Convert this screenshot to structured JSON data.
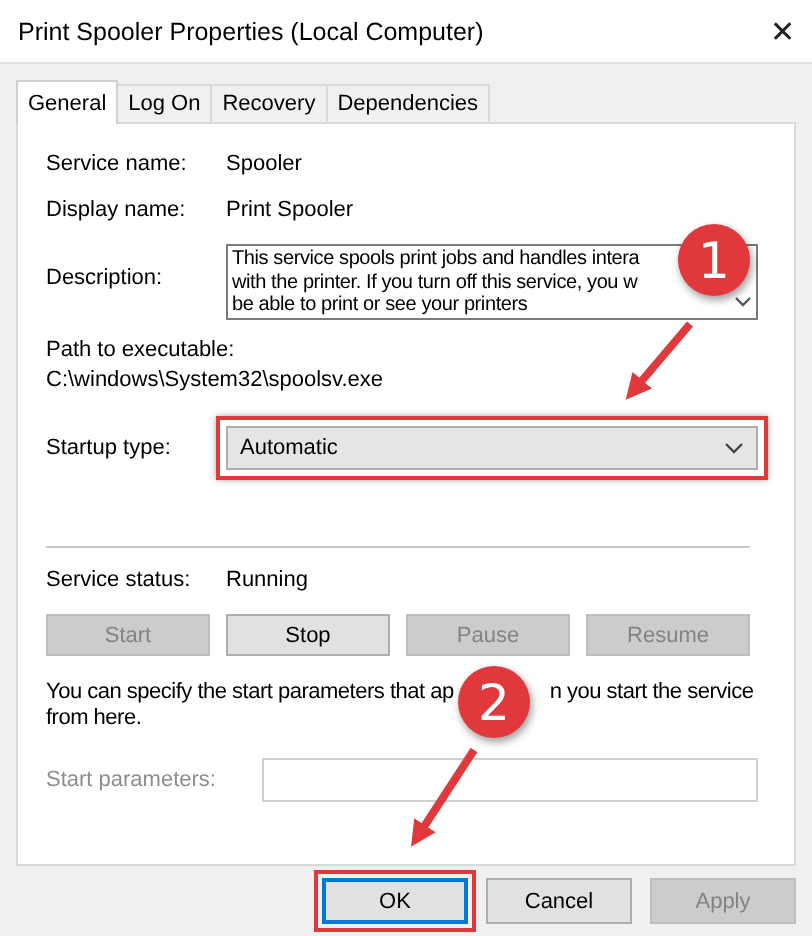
{
  "window": {
    "title": "Print Spooler Properties (Local Computer)",
    "close": "✕"
  },
  "tabs": [
    {
      "label": "General",
      "selected": true
    },
    {
      "label": "Log On",
      "selected": false
    },
    {
      "label": "Recovery",
      "selected": false
    },
    {
      "label": "Dependencies",
      "selected": false
    }
  ],
  "service_name": {
    "label": "Service name:",
    "value": "Spooler"
  },
  "display_name": {
    "label": "Display name:",
    "value": "Print Spooler"
  },
  "description": {
    "label": "Description:",
    "lines": [
      "This service spools print jobs and handles intera",
      "with the printer.  If you turn off this service, you w",
      "be able to print or see your printers"
    ]
  },
  "path": {
    "label": "Path to executable:",
    "value": "C:\\windows\\System32\\spoolsv.exe"
  },
  "startup_type": {
    "label": "Startup type:",
    "value": "Automatic",
    "highlighted": true
  },
  "service_status": {
    "label": "Service status:",
    "value": "Running"
  },
  "service_buttons": [
    {
      "label": "Start",
      "disabled": true
    },
    {
      "label": "Stop",
      "disabled": false
    },
    {
      "label": "Pause",
      "disabled": true
    },
    {
      "label": "Resume",
      "disabled": true
    }
  ],
  "note": {
    "line_1_start": "You can specify the start parameters that ap",
    "line_1_end": "n you start the service",
    "line_2": "from here."
  },
  "start_parameters": {
    "label": "Start parameters:",
    "disabled": true
  },
  "dialog_buttons": [
    {
      "label": "OK",
      "disabled": false,
      "default": true,
      "highlighted": true
    },
    {
      "label": "Cancel",
      "disabled": false,
      "default": false,
      "highlighted": false
    },
    {
      "label": "Apply",
      "disabled": true,
      "default": false,
      "highlighted": false
    }
  ],
  "annotations": [
    {
      "number": "1"
    },
    {
      "number": "2"
    }
  ]
}
